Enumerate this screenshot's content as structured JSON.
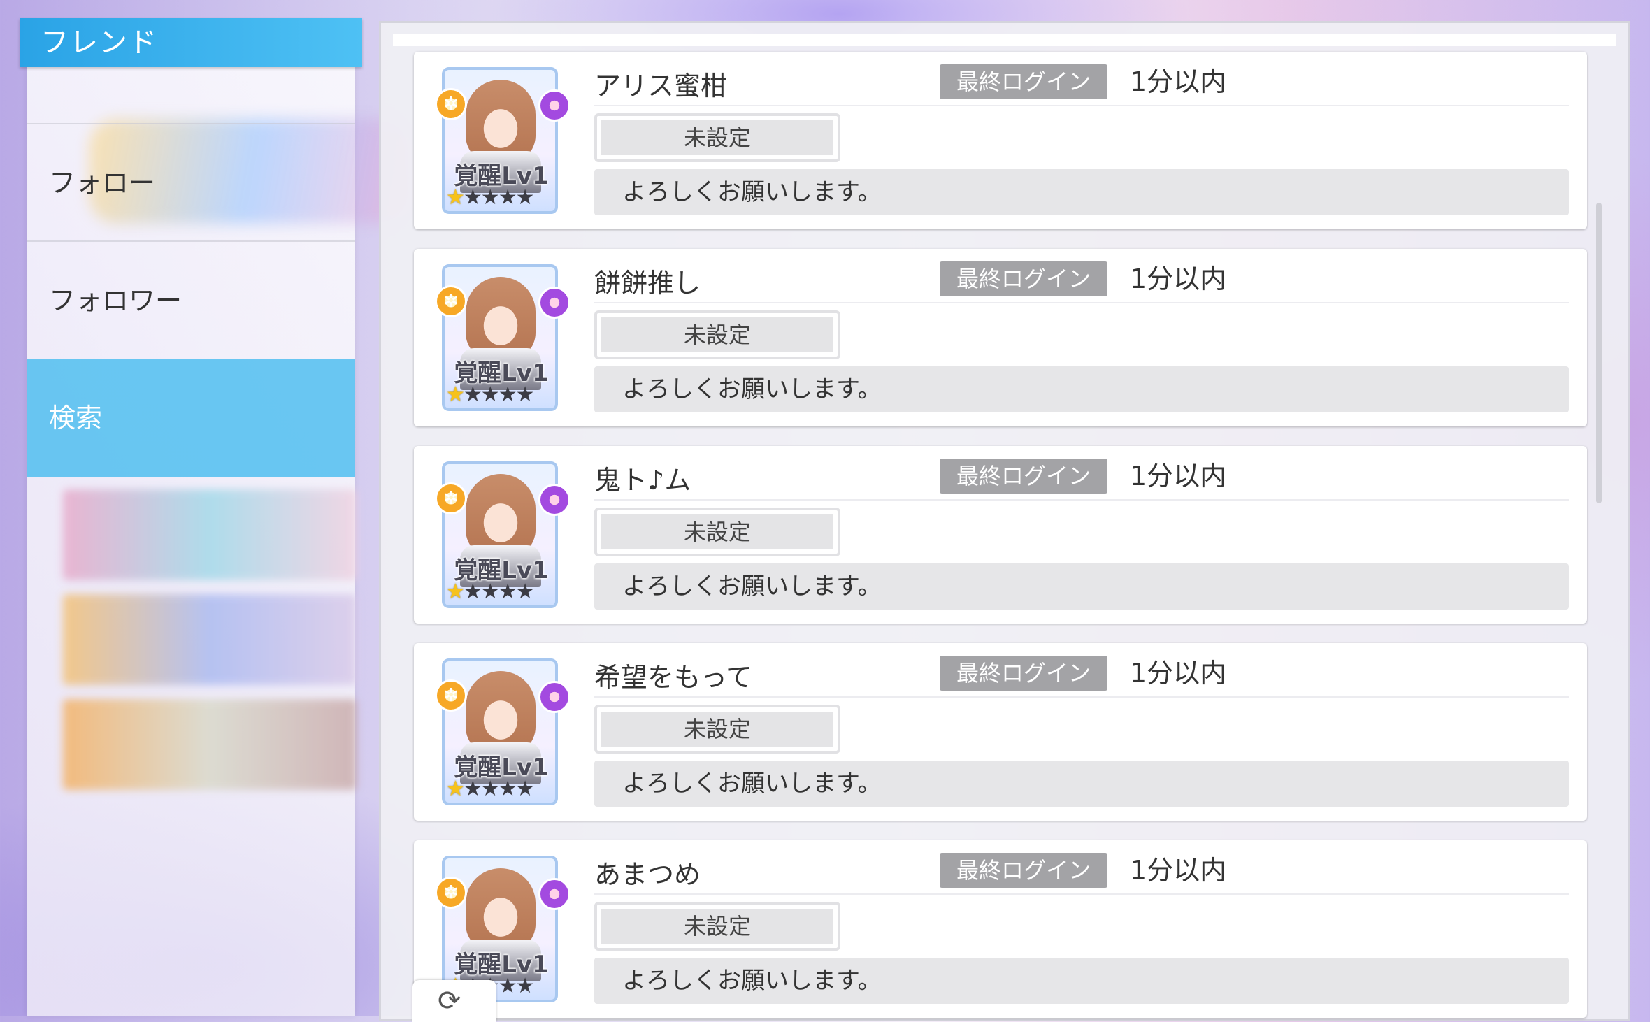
{
  "sidebar": {
    "header": "フレンド",
    "items": [
      {
        "label": "フォロー"
      },
      {
        "label": "フォロワー"
      },
      {
        "label": "検索"
      }
    ]
  },
  "friends": [
    {
      "name": "アリス蜜柑",
      "login_label": "最終ログイン",
      "login_time": "1分以内",
      "status": "未設定",
      "message": "よろしくお願いします。",
      "awake_level": "覚醒Lv1",
      "rarity_stars": 1
    },
    {
      "name": "餅餅推し",
      "login_label": "最終ログイン",
      "login_time": "1分以内",
      "status": "未設定",
      "message": "よろしくお願いします。",
      "awake_level": "覚醒Lv1",
      "rarity_stars": 1
    },
    {
      "name": "鬼ト♪ム",
      "login_label": "最終ログイン",
      "login_time": "1分以内",
      "status": "未設定",
      "message": "よろしくお願いします。",
      "awake_level": "覚醒Lv1",
      "rarity_stars": 1
    },
    {
      "name": "希望をもって",
      "login_label": "最終ログイン",
      "login_time": "1分以内",
      "status": "未設定",
      "message": "よろしくお願いします。",
      "awake_level": "覚醒Lv1",
      "rarity_stars": 1
    },
    {
      "name": "あまつめ",
      "login_label": "最終ログイン",
      "login_time": "1分以内",
      "status": "未設定",
      "message": "よろしくお願いします。",
      "awake_level": "覚醒Lv1",
      "rarity_stars": 1
    }
  ],
  "icons": {
    "refresh": "refresh-icon",
    "star": "star-icon"
  },
  "colors": {
    "accent": "#2aa3e6",
    "active_tab": "#50bef0",
    "login_badge": "#a3a3a6"
  }
}
